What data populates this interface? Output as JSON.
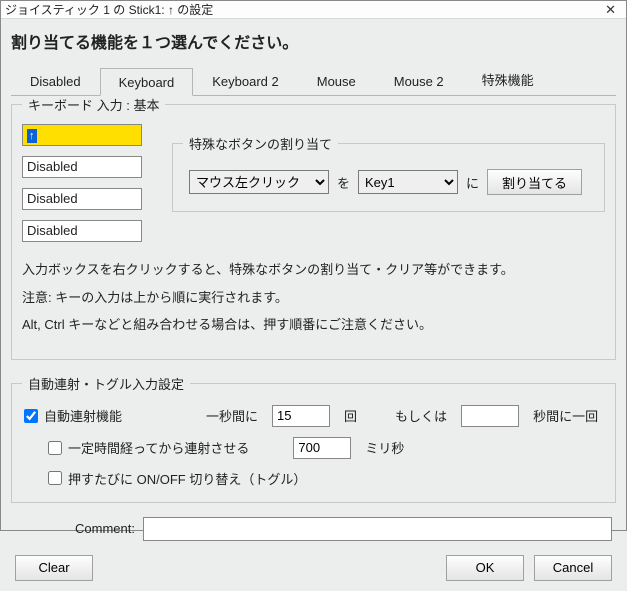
{
  "title": "ジョイスティック 1 の Stick1: ↑ の設定",
  "heading": "割り当てる機能を１つ選んでください。",
  "tabs": {
    "disabled": "Disabled",
    "keyboard": "Keyboard",
    "keyboard2": "Keyboard 2",
    "mouse": "Mouse",
    "mouse2": "Mouse 2",
    "special": "特殊機能"
  },
  "groupbox": {
    "legend": "キーボード 入力 : 基本",
    "slot1": "↑",
    "slot2": "Disabled",
    "slot3": "Disabled",
    "slot4": "Disabled"
  },
  "assign": {
    "legend": "特殊なボタンの割り当て",
    "select1": "マウス左クリック",
    "mid1": "を",
    "select2": "Key1",
    "mid2": "に",
    "button": "割り当てる"
  },
  "notes": {
    "line1": "入力ボックスを右クリックすると、特殊なボタンの割り当て・クリア等ができます。",
    "line2": "注意: キーの入力は上から順に実行されます。",
    "line3": "Alt, Ctrl キーなどと組み合わせる場合は、押す順番にご注意ください。"
  },
  "auto": {
    "legend": "自動連射・トグル入力設定",
    "autofire_label": "自動連射機能",
    "per_sec_pre": "一秒間に",
    "per_sec_val": "15",
    "per_sec_post": "回",
    "or_label": "もしくは",
    "interval_val": "",
    "interval_post": "秒間に一回",
    "delay_label": "一定時間経ってから連射させる",
    "delay_val": "700",
    "delay_post": "ミリ秒",
    "toggle_label": "押すたびに ON/OFF 切り替え（トグル）"
  },
  "footer": {
    "comment_label": "Comment:",
    "clear": "Clear",
    "ok": "OK",
    "cancel": "Cancel"
  }
}
